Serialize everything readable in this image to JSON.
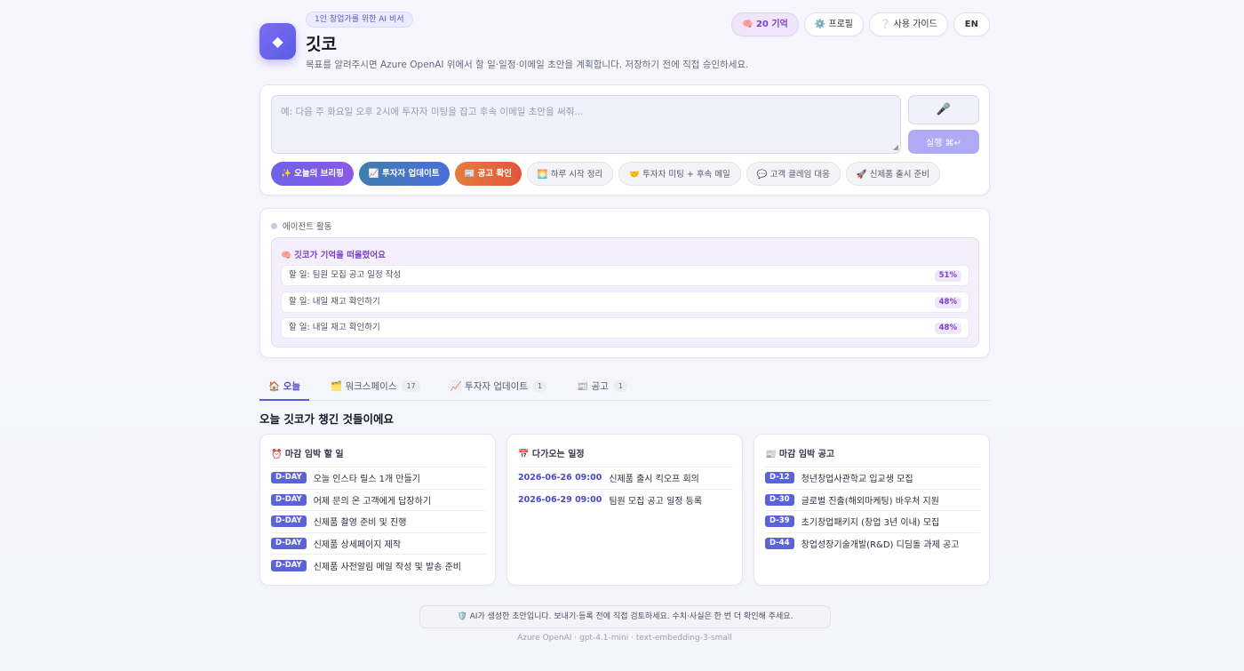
{
  "header": {
    "badge": "1인 창업가를 위한 AI 비서",
    "title": "깃코",
    "description": "목표를 알려주시면 Azure OpenAI 위에서 할 일·일정·이메일 초안을 계획합니다. 저장하기 전에 직접 승인하세요.",
    "memory_btn": "🧠 20 기억",
    "profile_btn": "⚙️ 프로필",
    "guide_btn": "❔ 사용 가이드",
    "lang_btn": "EN"
  },
  "composer": {
    "placeholder": "예: 다음 주 화요일 오후 2시에 투자자 미팅을 잡고 후속 이메일 초안을 써줘...",
    "mic": "🎤",
    "run": "실행 ⌘↵",
    "chips": [
      "✨ 오늘의 브리핑",
      "📈 투자자 업데이트",
      "📰 공고 확인",
      "🌅 하루 시작 정리",
      "🤝 투자자 미팅 + 후속 메일",
      "💬 고객 클레임 대응",
      "🚀 신제품 출시 준비"
    ]
  },
  "agent": {
    "heading": "에이전트 활동",
    "memory_title": "🧠 깃코가 기억을 떠올렸어요",
    "memories": [
      {
        "text": "할 일: 팀원 모집 공고 일정 작성",
        "pct": "51%"
      },
      {
        "text": "할 일: 내일 재고 확인하기",
        "pct": "48%"
      },
      {
        "text": "할 일: 내일 재고 확인하기",
        "pct": "48%"
      }
    ]
  },
  "tabs": [
    {
      "label": "🏠 오늘",
      "count": ""
    },
    {
      "label": "🗂️ 워크스페이스",
      "count": "17"
    },
    {
      "label": "📈 투자자 업데이트",
      "count": "1"
    },
    {
      "label": "📰 공고",
      "count": "1"
    }
  ],
  "today": {
    "title": "오늘 깃코가 챙긴 것들이에요",
    "tasks": {
      "title": "⏰ 마감 임박 할 일",
      "items": [
        {
          "tag": "D-DAY",
          "text": "오늘 인스타 릴스 1개 만들기"
        },
        {
          "tag": "D-DAY",
          "text": "어제 문의 온 고객에게 답장하기"
        },
        {
          "tag": "D-DAY",
          "text": "신제품 촬영 준비 및 진행"
        },
        {
          "tag": "D-DAY",
          "text": "신제품 상세페이지 제작"
        },
        {
          "tag": "D-DAY",
          "text": "신제품 사전알림 메일 작성 및 발송 준비"
        }
      ]
    },
    "schedule": {
      "title": "📅 다가오는 일정",
      "items": [
        {
          "date": "2026-06-26 09:00",
          "text": "신제품 출시 킥오프 회의"
        },
        {
          "date": "2026-06-29 09:00",
          "text": "팀원 모집 공고 일정 등록"
        }
      ]
    },
    "notices": {
      "title": "📰 마감 임박 공고",
      "items": [
        {
          "tag": "D-12",
          "text": "청년창업사관학교 입교생 모집"
        },
        {
          "tag": "D-30",
          "text": "글로벌 진출(해외마케팅) 바우처 지원"
        },
        {
          "tag": "D-39",
          "text": "초기창업패키지 (창업 3년 이내) 모집"
        },
        {
          "tag": "D-44",
          "text": "창업성장기술개발(R&D) 디딤돌 과제 공고"
        }
      ]
    }
  },
  "notice": "🛡️ AI가 생성한 초안입니다. 보내기·등록 전에 직접 검토하세요. 수치·사실은 한 번 더 확인해 주세요.",
  "footer": "Azure OpenAI · gpt-4.1-mini · text-embedding-3-small"
}
